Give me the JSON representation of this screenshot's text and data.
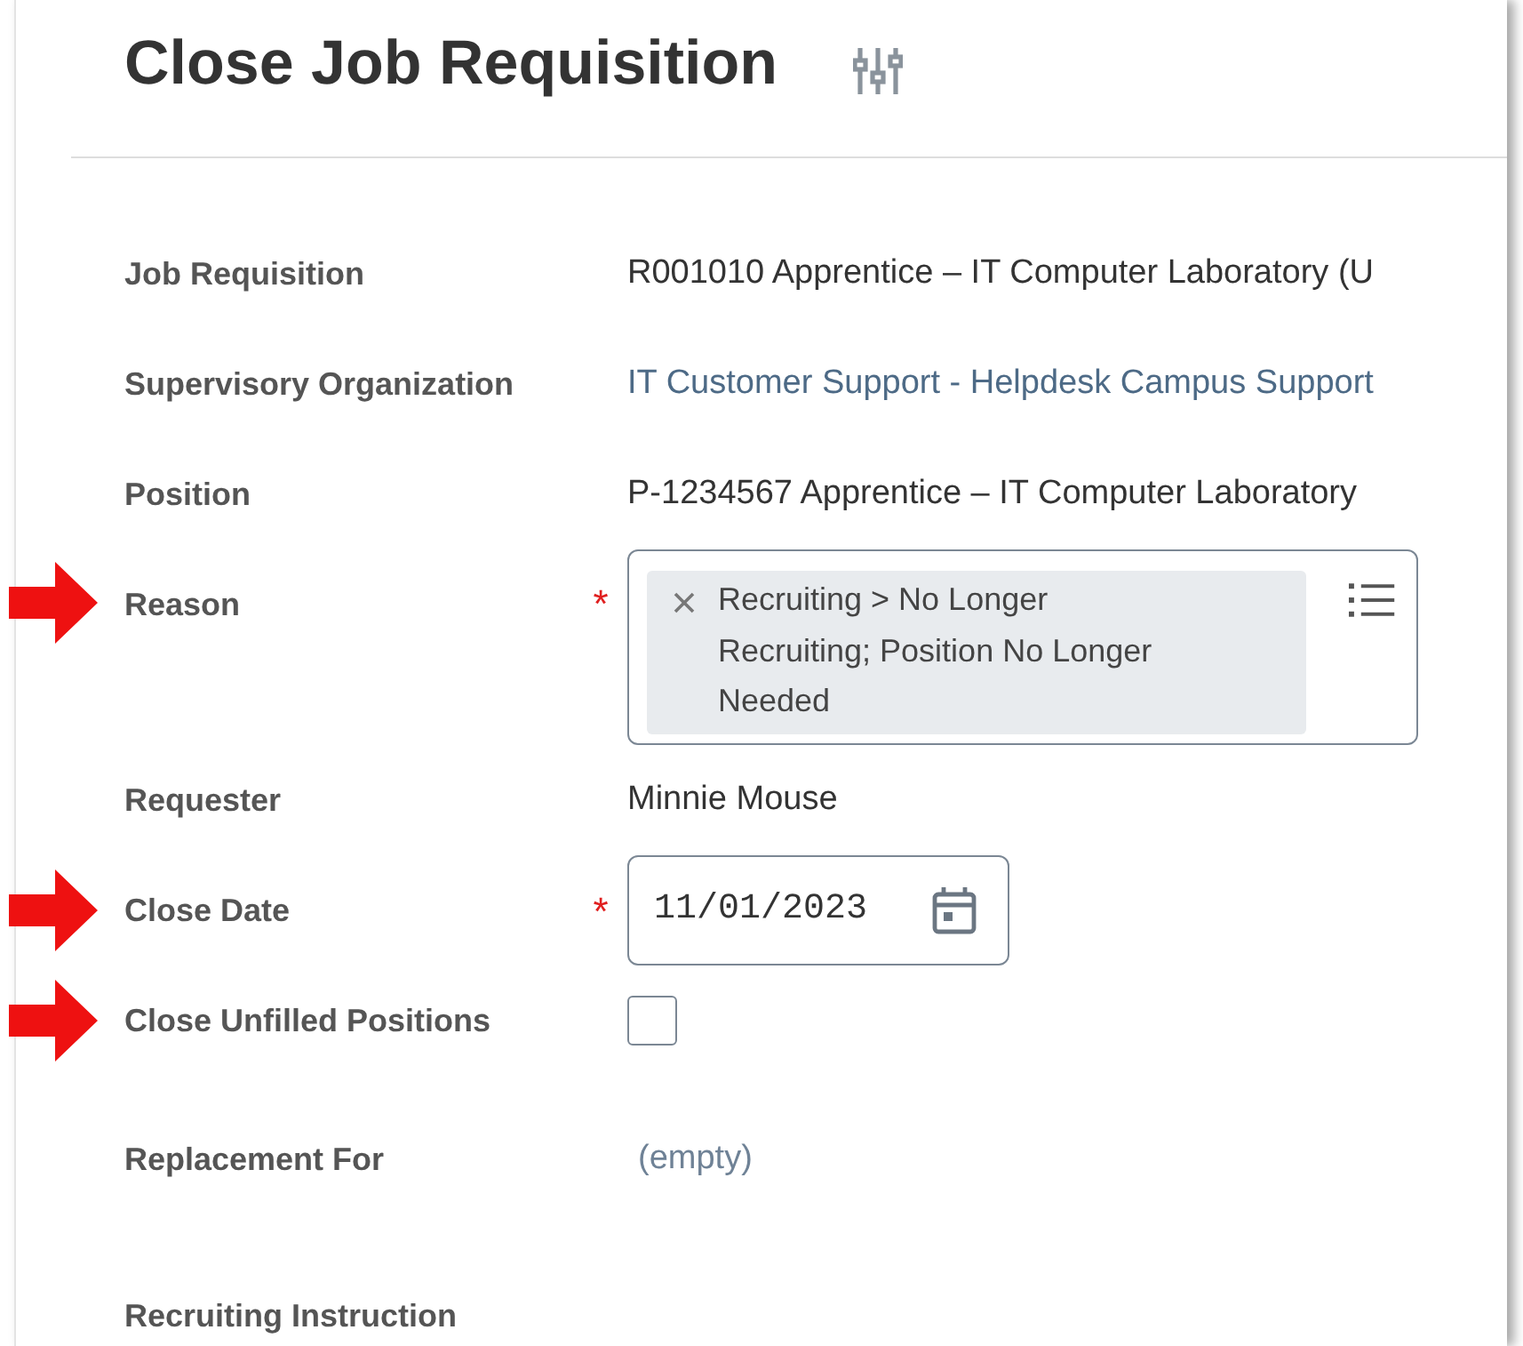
{
  "title": "Close Job Requisition",
  "fields": [
    {
      "label": "Job Requisition",
      "kind": "text",
      "value": "R001010 Apprentice – IT Computer Laboratory (U",
      "required": false,
      "flagged": false
    },
    {
      "label": "Supervisory Organization",
      "kind": "link",
      "value": "IT Customer Support - Helpdesk Campus Support",
      "required": false,
      "flagged": false
    },
    {
      "label": "Position",
      "kind": "text",
      "value": "P-1234567 Apprentice – IT Computer Laboratory",
      "required": false,
      "flagged": false
    },
    {
      "label": "Reason",
      "kind": "multiselect",
      "value": "Recruiting > No Longer Recruiting; Position No Longer Needed",
      "required": true,
      "required_marker": "*",
      "flagged": true
    },
    {
      "label": "Requester",
      "kind": "text",
      "value": "Minnie Mouse",
      "required": false,
      "flagged": false
    },
    {
      "label": "Close Date",
      "kind": "date",
      "value": "11/01/2023",
      "required": true,
      "required_marker": "*",
      "flagged": true
    },
    {
      "label": "Close Unfilled Positions",
      "kind": "checkbox",
      "checked": false,
      "required": false,
      "flagged": true
    },
    {
      "label": "Replacement For",
      "kind": "empty",
      "value": "(empty)",
      "required": false,
      "flagged": false
    },
    {
      "label": "Recruiting Instruction",
      "kind": "text",
      "required": false,
      "flagged": false
    }
  ]
}
